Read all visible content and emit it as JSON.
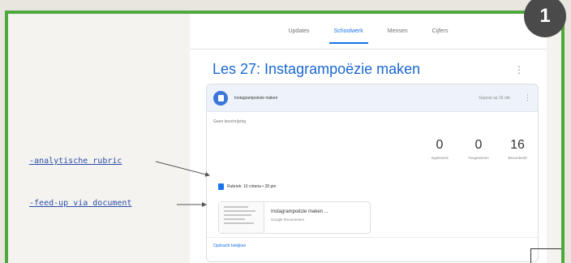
{
  "badge": "1",
  "tabs": [
    {
      "label": "Updates"
    },
    {
      "label": "Schoolwerk"
    },
    {
      "label": "Mensen"
    },
    {
      "label": "Cijfers"
    }
  ],
  "assignment": {
    "title": "Les 27: Instagrampoëzie maken",
    "head_title": "Instagrampoëzie maken",
    "head_date": "Gepost op 15 okt.",
    "no_description": "Geen beschrijving",
    "stats": [
      {
        "value": "0",
        "label": "Ingeleverd"
      },
      {
        "value": "0",
        "label": "Toegewezen"
      },
      {
        "value": "16",
        "label": "Beoordeeld"
      }
    ],
    "rubric": "Rubriek: 10 criteria • 28 ptn",
    "attachment": {
      "name": "Instagrampoëzie maken ...",
      "type": "Google Documenten"
    },
    "view_link": "Opdracht bekijken"
  },
  "annotations": {
    "rubric": "analytische rubric",
    "feedup": "feed-up via document",
    "dash": "-"
  },
  "colors": {
    "frame": "#4fa83d",
    "accent": "#1a73e8",
    "annotation": "#2b4ea8"
  }
}
